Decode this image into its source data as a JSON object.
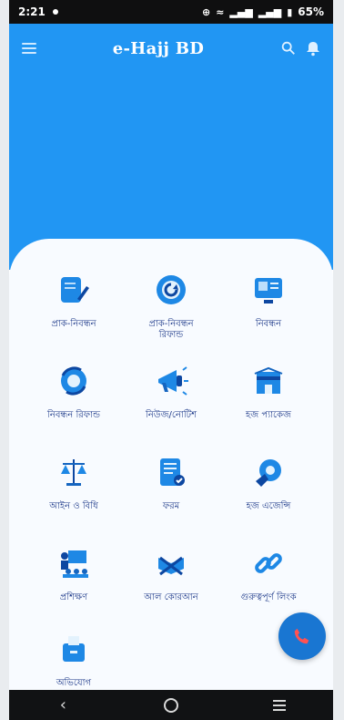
{
  "status_bar": {
    "time": "2:21",
    "battery": "65%"
  },
  "app_bar": {
    "title": "e-Hajj BD"
  },
  "menu_items": [
    {
      "label": "প্রাক-নিবন্ধন",
      "icon": "pre-registration-icon"
    },
    {
      "label": "প্রাক-নিবন্ধন\nরিফান্ড",
      "icon": "pre-registration-refund-icon"
    },
    {
      "label": "নিবন্ধন",
      "icon": "registration-icon"
    },
    {
      "label": "নিবন্ধন রিফান্ড",
      "icon": "registration-refund-icon"
    },
    {
      "label": "নিউজ/নোটিশ",
      "icon": "news-notice-icon"
    },
    {
      "label": "হজ প্যাকেজ",
      "icon": "hajj-package-icon"
    },
    {
      "label": "আইন ও বিধি",
      "icon": "law-rules-icon"
    },
    {
      "label": "ফরম",
      "icon": "form-icon"
    },
    {
      "label": "হজ এজেন্সি",
      "icon": "hajj-agency-icon"
    },
    {
      "label": "প্রশিক্ষণ",
      "icon": "training-icon"
    },
    {
      "label": "আল কোরআন",
      "icon": "al-quran-icon"
    },
    {
      "label": "গুরুত্বপূর্ণ লিংক",
      "icon": "important-link-icon"
    },
    {
      "label": "অভিযোগ",
      "icon": "complaint-icon"
    }
  ],
  "colors": {
    "primary": "#2196f3",
    "accent": "#1976d2",
    "card": "#f8fbff",
    "label": "#1e3a8a"
  }
}
